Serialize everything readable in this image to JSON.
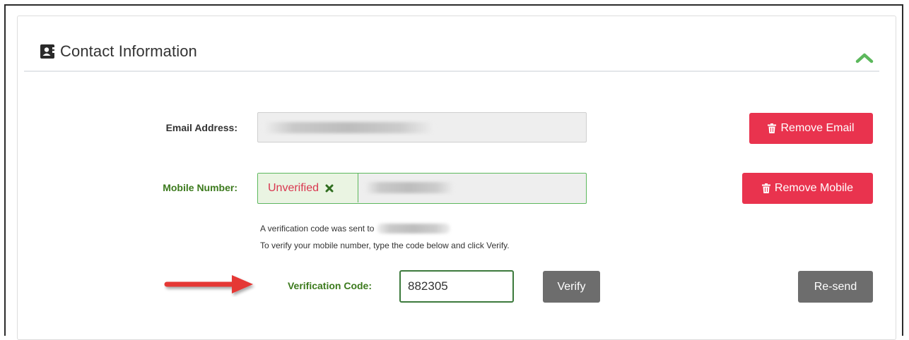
{
  "panel": {
    "title": "Contact Information",
    "icons": {
      "header": "contact-card-icon",
      "collapse": "chevron-up-icon"
    },
    "accent_green": "#5cb85c"
  },
  "email": {
    "label": "Email Address:",
    "remove_label": "Remove Email"
  },
  "mobile": {
    "label": "Mobile Number:",
    "status": "Unverified",
    "remove_label": "Remove Mobile"
  },
  "verification": {
    "sent_text": "A verification code was sent to",
    "instructions": "To verify your mobile number, type the code below and click Verify.",
    "code_label": "Verification Code:",
    "code_value": "882305",
    "verify_label": "Verify",
    "resend_label": "Re-send"
  },
  "colors": {
    "danger": "#e9334e",
    "neutral_button": "#6d6d6d",
    "label_green": "#3c7a1d",
    "arrow_red": "#e53935"
  }
}
